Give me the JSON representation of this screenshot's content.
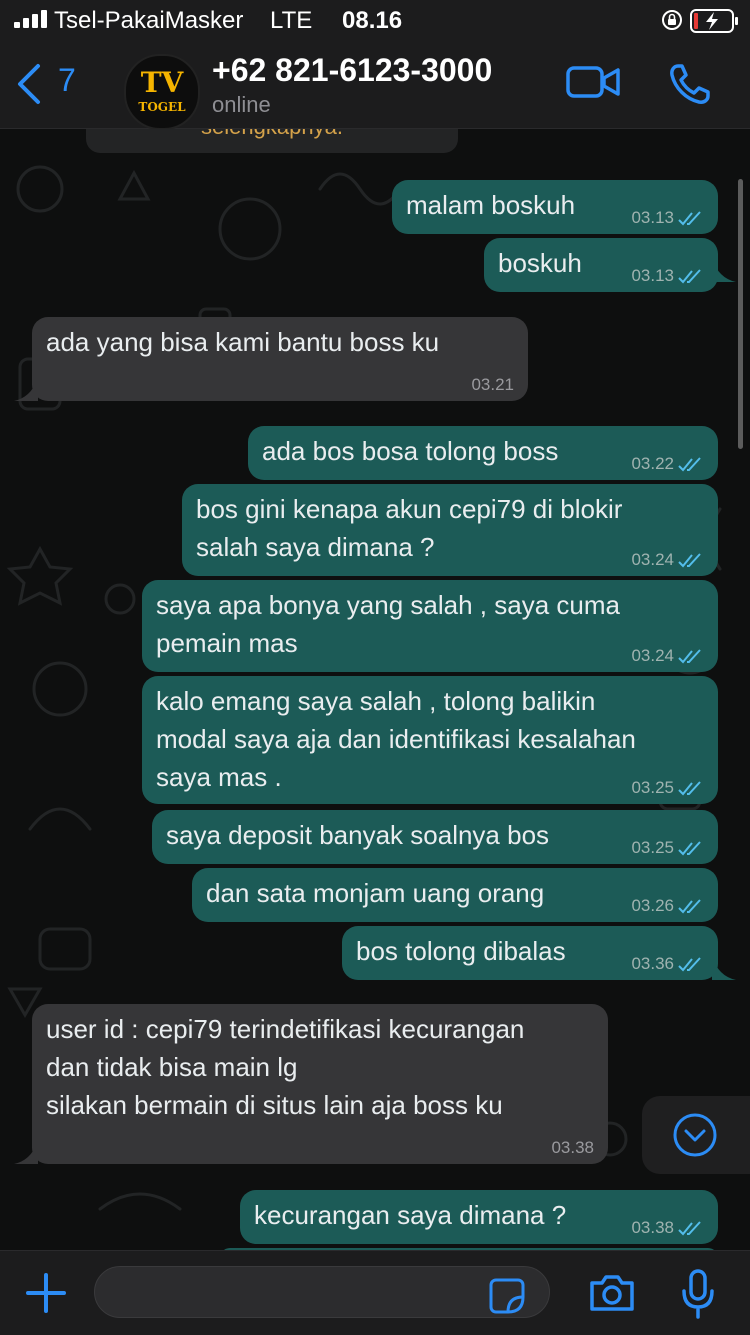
{
  "status_bar": {
    "carrier": "Tsel-PakaiMasker",
    "network": "LTE",
    "time": "08.16"
  },
  "header": {
    "back_count": "7",
    "avatar_text_top": "TV",
    "avatar_text_bottom": "TOGEL",
    "contact_name": "+62 821-6123-3000",
    "contact_status": "online"
  },
  "chat": {
    "clipped_text": "selengkapnya.",
    "messages": [
      {
        "dir": "out",
        "text": "malam boskuh",
        "time": "03.13"
      },
      {
        "dir": "out",
        "text": "boskuh",
        "time": "03.13"
      },
      {
        "dir": "in",
        "text": "ada yang bisa kami bantu boss ku",
        "time": "03.21"
      },
      {
        "dir": "out",
        "text": "ada bos bosa tolong boss",
        "time": "03.22"
      },
      {
        "dir": "out",
        "text": "bos gini kenapa akun cepi79 di blokir\nsalah saya dimana ?",
        "time": "03.24"
      },
      {
        "dir": "out",
        "text": "saya apa bonya yang salah , saya cuma\npemain mas",
        "time": "03.24"
      },
      {
        "dir": "out",
        "text": "kalo emang saya salah , tolong balikin\nmodal saya aja dan identifikasi kesalahan\nsaya mas .",
        "time": "03.25"
      },
      {
        "dir": "out",
        "text": "saya deposit banyak soalnya bos",
        "time": "03.25"
      },
      {
        "dir": "out",
        "text": "dan sata monjam uang orang",
        "time": "03.26"
      },
      {
        "dir": "out",
        "text": "bos tolong dibalas",
        "time": "03.36"
      },
      {
        "dir": "in",
        "text": "user id : cepi79 terindetifikasi kecurangan\ndan tidak bisa main lg\nsilakan bermain di situs lain aja boss ku",
        "time": "03.38"
      },
      {
        "dir": "out",
        "text": "kecurangan saya dimana ?",
        "time": "03.38"
      }
    ]
  },
  "composer": {
    "placeholder": ""
  },
  "colors": {
    "accent": "#2c8cf5",
    "outgoing_bubble": "#1c5b57",
    "incoming_bubble": "#363638",
    "read_tick": "#53bdeb"
  }
}
